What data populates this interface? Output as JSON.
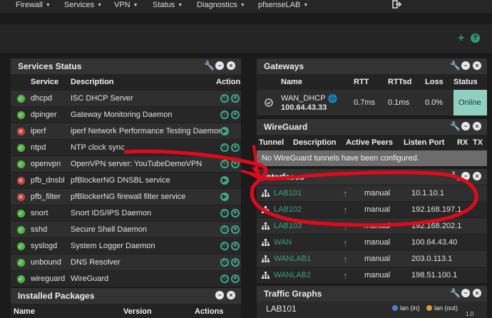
{
  "nav": {
    "items": [
      "Firewall",
      "Services",
      "VPN",
      "Status",
      "Diagnostics",
      "pfsenseLAB"
    ],
    "logout_icon": "logout-icon"
  },
  "toolbar": {
    "add_icon": "plus-icon",
    "help_icon": "help-icon"
  },
  "services": {
    "title": "Services Status",
    "headers": {
      "service": "Service",
      "description": "Description",
      "action": "Action"
    },
    "rows": [
      {
        "status": "running",
        "name": "dhcpd",
        "desc": "ISC DHCP Server"
      },
      {
        "status": "running",
        "name": "dpinger",
        "desc": "Gateway Monitoring Daemon"
      },
      {
        "status": "stopped",
        "name": "iperf",
        "desc": "iperf Network Performance Testing Daemon"
      },
      {
        "status": "running",
        "name": "ntpd",
        "desc": "NTP clock sync"
      },
      {
        "status": "running",
        "name": "openvpn",
        "desc": "OpenVPN server: YouTubeDemoVPN"
      },
      {
        "status": "stopped",
        "name": "pfb_dnsbl",
        "desc": "pfBlockerNG DNSBL service"
      },
      {
        "status": "stopped",
        "name": "pfb_filter",
        "desc": "pfBlockerNG firewall filter service"
      },
      {
        "status": "running",
        "name": "snort",
        "desc": "Snort IDS/IPS Daemon"
      },
      {
        "status": "running",
        "name": "sshd",
        "desc": "Secure Shell Daemon"
      },
      {
        "status": "running",
        "name": "syslogd",
        "desc": "System Logger Daemon"
      },
      {
        "status": "running",
        "name": "unbound",
        "desc": "DNS Resolver"
      },
      {
        "status": "running",
        "name": "wireguard",
        "desc": "WireGuard"
      }
    ]
  },
  "packages": {
    "title": "Installed Packages",
    "headers": {
      "name": "Name",
      "version": "Version",
      "actions": "Actions"
    }
  },
  "gateways": {
    "title": "Gateways",
    "headers": {
      "name": "Name",
      "rtt": "RTT",
      "rttsd": "RTTsd",
      "loss": "Loss",
      "status": "Status"
    },
    "rows": [
      {
        "name": "WAN_DHCP",
        "ip": "100.64.43.33",
        "rtt": "0.7ms",
        "rttsd": "0.1ms",
        "loss": "0.0%",
        "status": "Online"
      }
    ]
  },
  "wireguard": {
    "title": "WireGuard",
    "headers": {
      "tunnel": "Tunnel",
      "description": "Description",
      "peers": "Active Peers",
      "port": "Listen Port",
      "rx": "RX",
      "tx": "TX"
    },
    "empty_msg": "No WireGuard tunnels have been configured."
  },
  "interfaces": {
    "title": "Interfaces",
    "rows": [
      {
        "name": "LAB101",
        "mode": "manual",
        "ip": "10.1.10.1"
      },
      {
        "name": "LAB102",
        "mode": "manual",
        "ip": "192.168.197.1"
      },
      {
        "name": "LAB103",
        "mode": "manual",
        "ip": "192.168.202.1"
      },
      {
        "name": "WAN",
        "mode": "manual",
        "ip": "100.64.43.40"
      },
      {
        "name": "WANLAB1",
        "mode": "manual",
        "ip": "203.0.113.1"
      },
      {
        "name": "WANLAB2",
        "mode": "manual",
        "ip": "198.51.100.1"
      }
    ]
  },
  "traffic": {
    "title": "Traffic Graphs",
    "graph_name": "LAB101",
    "legend_in": "lan (in)",
    "legend_out": "lan (out)",
    "axis_max": "1.0",
    "legend_in_color": "#4a7fd8",
    "legend_out_color": "#e59a3a"
  },
  "colors": {
    "accent": "#3a9f84",
    "annotation": "#e3091b"
  }
}
